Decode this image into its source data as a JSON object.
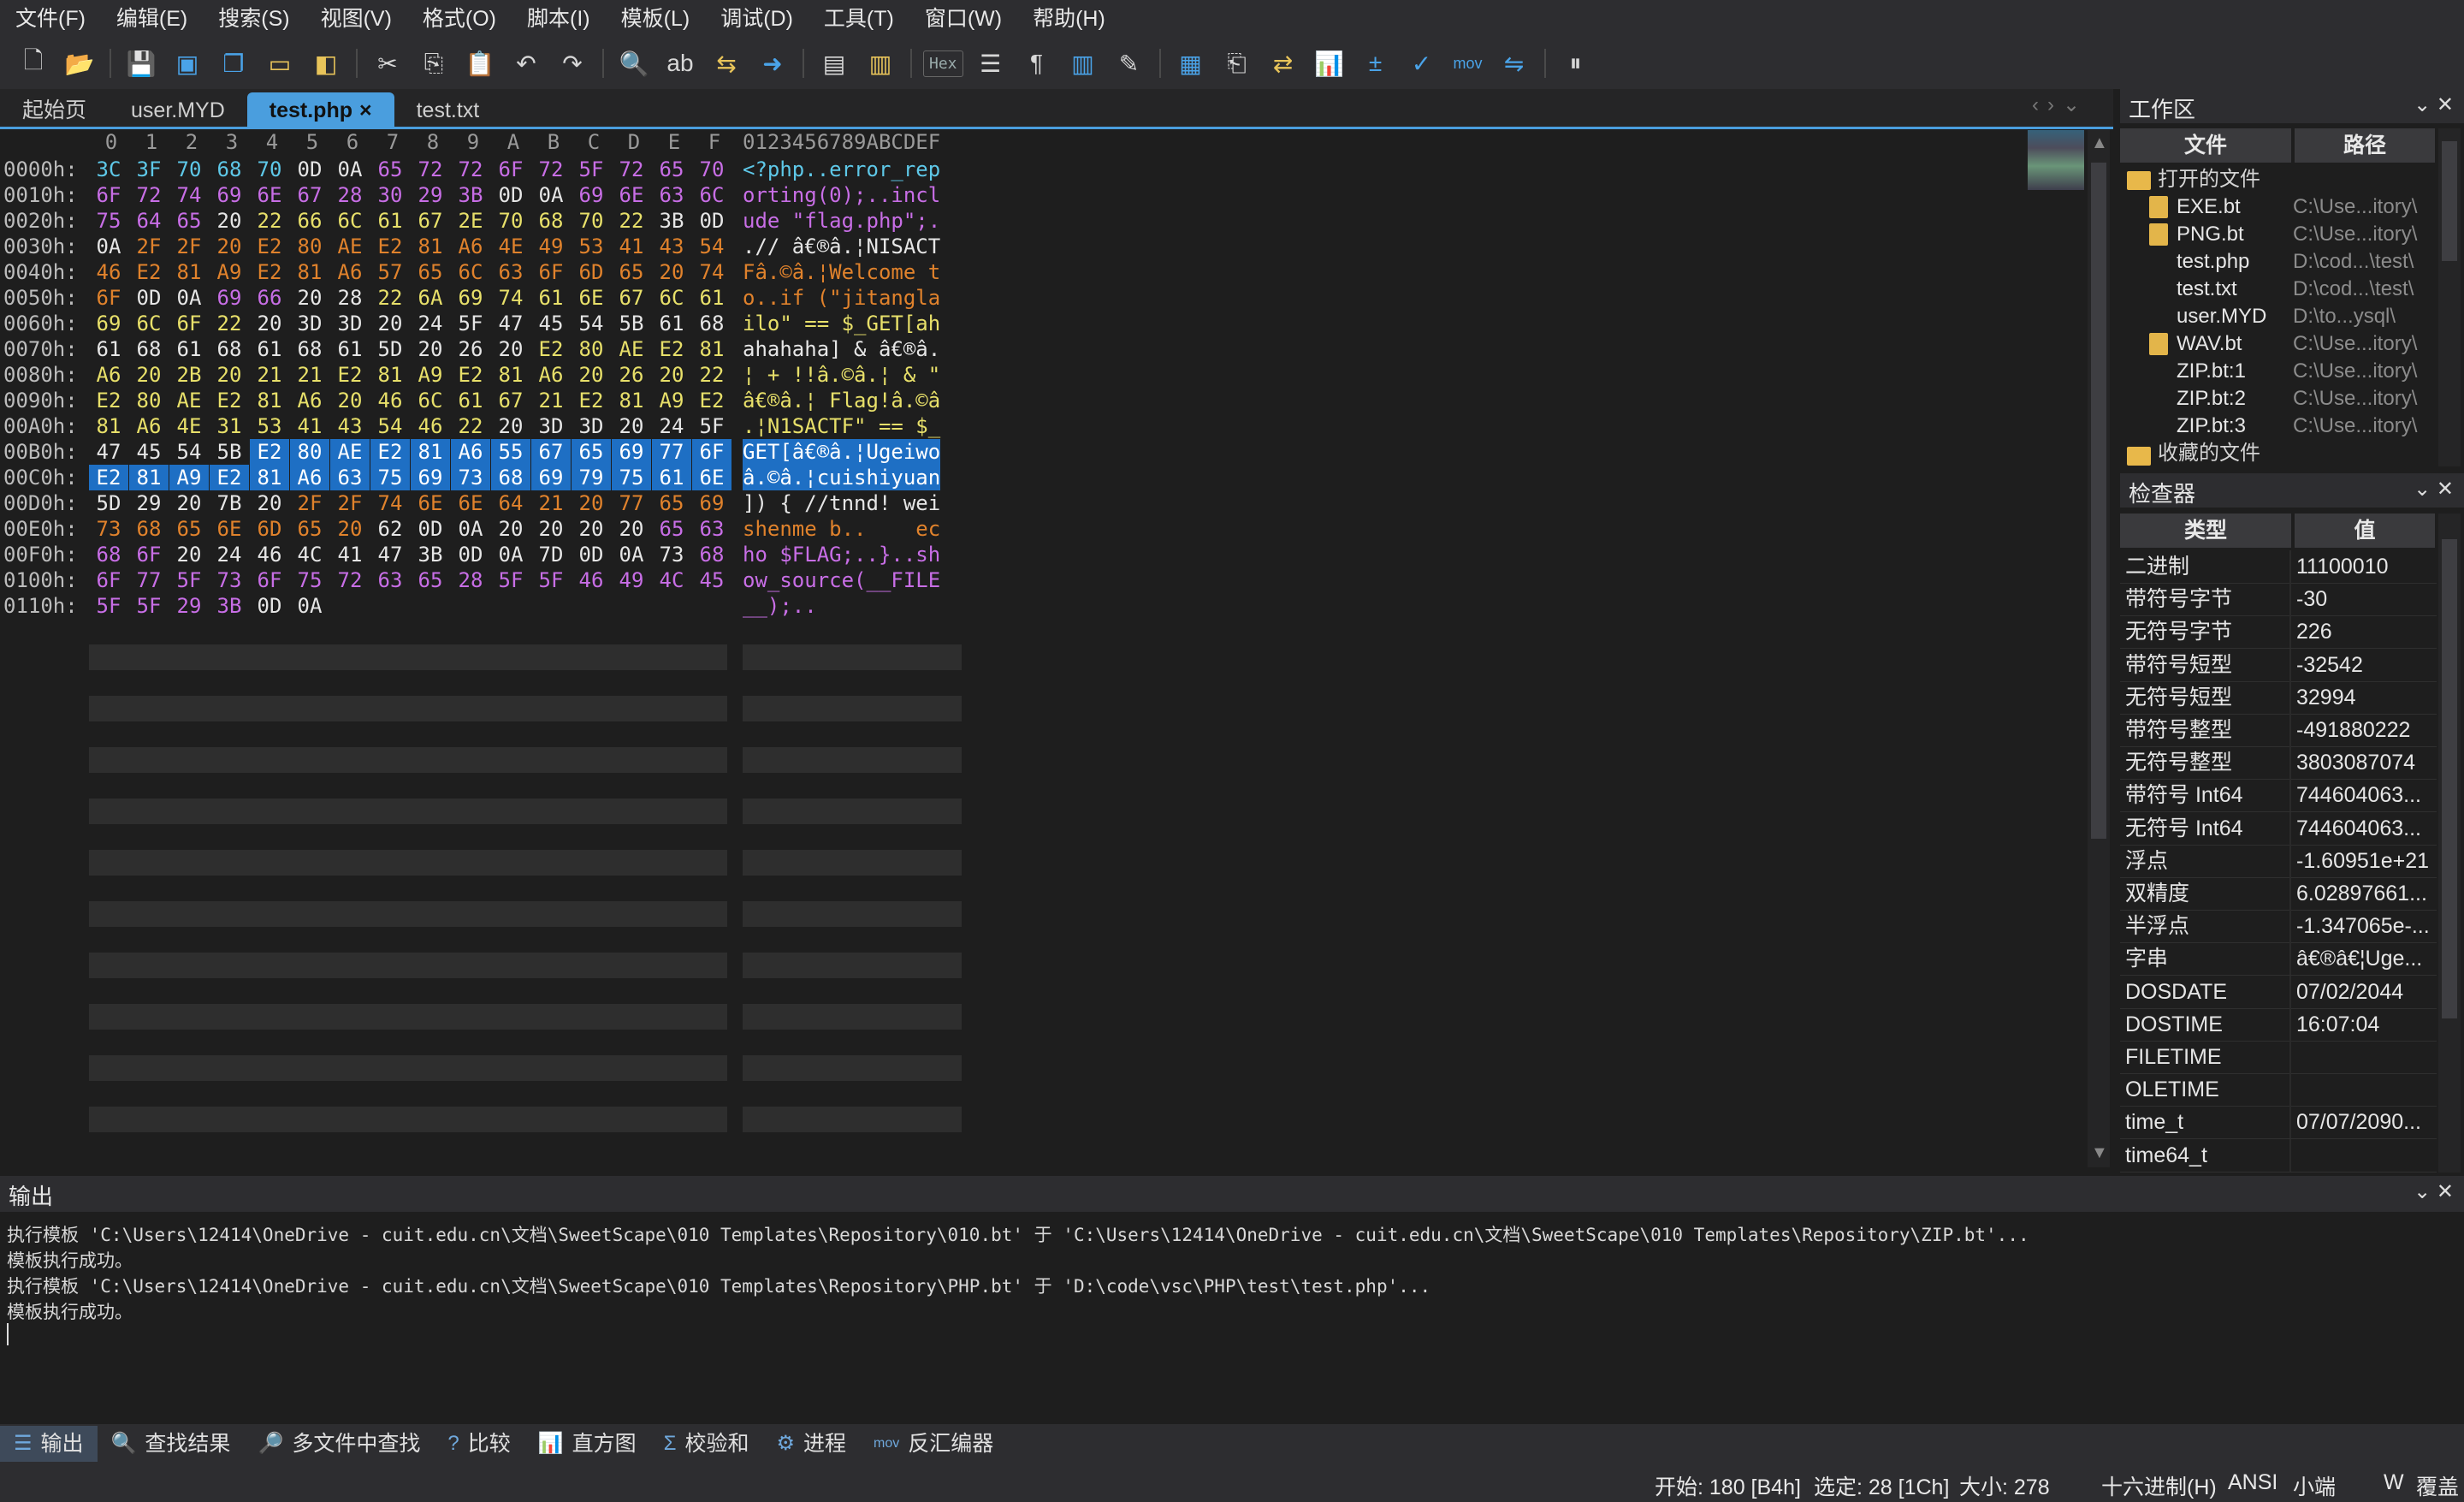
{
  "menu": [
    "文件(F)",
    "编辑(E)",
    "搜索(S)",
    "视图(V)",
    "格式(O)",
    "脚本(I)",
    "模板(L)",
    "调试(D)",
    "工具(T)",
    "窗口(W)",
    "帮助(H)"
  ],
  "toolbar": {
    "hex_label": "Hex",
    "mov_label": "mov"
  },
  "tabs": [
    {
      "label": "起始页",
      "active": false
    },
    {
      "label": "user.MYD",
      "active": false
    },
    {
      "label": "test.php",
      "active": true,
      "close": "×"
    },
    {
      "label": "test.txt",
      "active": false
    }
  ],
  "hex": {
    "columns": [
      "0",
      "1",
      "2",
      "3",
      "4",
      "5",
      "6",
      "7",
      "8",
      "9",
      "A",
      "B",
      "C",
      "D",
      "E",
      "F"
    ],
    "ascii_header": "0123456789ABCDEF",
    "rows": [
      {
        "offset": "0000h:",
        "bytes": [
          "3C",
          "3F",
          "70",
          "68",
          "70",
          "0D",
          "0A",
          "65",
          "72",
          "72",
          "6F",
          "72",
          "5F",
          "72",
          "65",
          "70"
        ],
        "ascii": "<?php..error_rep"
      },
      {
        "offset": "0010h:",
        "bytes": [
          "6F",
          "72",
          "74",
          "69",
          "6E",
          "67",
          "28",
          "30",
          "29",
          "3B",
          "0D",
          "0A",
          "69",
          "6E",
          "63",
          "6C"
        ],
        "ascii": "orting(0);..incl"
      },
      {
        "offset": "0020h:",
        "bytes": [
          "75",
          "64",
          "65",
          "20",
          "22",
          "66",
          "6C",
          "61",
          "67",
          "2E",
          "70",
          "68",
          "70",
          "22",
          "3B",
          "0D"
        ],
        "ascii": "ude \"flag.php\";."
      },
      {
        "offset": "0030h:",
        "bytes": [
          "0A",
          "2F",
          "2F",
          "20",
          "E2",
          "80",
          "AE",
          "E2",
          "81",
          "A6",
          "4E",
          "49",
          "53",
          "41",
          "43",
          "54"
        ],
        "ascii": ".// â€®â.¦NISACT"
      },
      {
        "offset": "0040h:",
        "bytes": [
          "46",
          "E2",
          "81",
          "A9",
          "E2",
          "81",
          "A6",
          "57",
          "65",
          "6C",
          "63",
          "6F",
          "6D",
          "65",
          "20",
          "74"
        ],
        "ascii": "Fâ.©â.¦Welcome t"
      },
      {
        "offset": "0050h:",
        "bytes": [
          "6F",
          "0D",
          "0A",
          "69",
          "66",
          "20",
          "28",
          "22",
          "6A",
          "69",
          "74",
          "61",
          "6E",
          "67",
          "6C",
          "61"
        ],
        "ascii": "o..if (\"jitangla"
      },
      {
        "offset": "0060h:",
        "bytes": [
          "69",
          "6C",
          "6F",
          "22",
          "20",
          "3D",
          "3D",
          "20",
          "24",
          "5F",
          "47",
          "45",
          "54",
          "5B",
          "61",
          "68"
        ],
        "ascii": "ilo\" == $_GET[ah"
      },
      {
        "offset": "0070h:",
        "bytes": [
          "61",
          "68",
          "61",
          "68",
          "61",
          "68",
          "61",
          "5D",
          "20",
          "26",
          "20",
          "E2",
          "80",
          "AE",
          "E2",
          "81"
        ],
        "ascii": "ahahaha] & â€®â."
      },
      {
        "offset": "0080h:",
        "bytes": [
          "A6",
          "20",
          "2B",
          "20",
          "21",
          "21",
          "E2",
          "81",
          "A9",
          "E2",
          "81",
          "A6",
          "20",
          "26",
          "20",
          "22"
        ],
        "ascii": "¦ + !!â.©â.¦ & \""
      },
      {
        "offset": "0090h:",
        "bytes": [
          "E2",
          "80",
          "AE",
          "E2",
          "81",
          "A6",
          "20",
          "46",
          "6C",
          "61",
          "67",
          "21",
          "E2",
          "81",
          "A9",
          "E2"
        ],
        "ascii": "â€®â.¦ Flag!â.©â"
      },
      {
        "offset": "00A0h:",
        "bytes": [
          "81",
          "A6",
          "4E",
          "31",
          "53",
          "41",
          "43",
          "54",
          "46",
          "22",
          "20",
          "3D",
          "3D",
          "20",
          "24",
          "5F"
        ],
        "ascii": ".¦N1SACTF\" == $_"
      },
      {
        "offset": "00B0h:",
        "bytes": [
          "47",
          "45",
          "54",
          "5B",
          "E2",
          "80",
          "AE",
          "E2",
          "81",
          "A6",
          "55",
          "67",
          "65",
          "69",
          "77",
          "6F"
        ],
        "ascii": "GET[â€®â.¦Ugeiwo"
      },
      {
        "offset": "00C0h:",
        "bytes": [
          "E2",
          "81",
          "A9",
          "E2",
          "81",
          "A6",
          "63",
          "75",
          "69",
          "73",
          "68",
          "69",
          "79",
          "75",
          "61",
          "6E"
        ],
        "ascii": "â.©â.¦cuishiyuan"
      },
      {
        "offset": "00D0h:",
        "bytes": [
          "5D",
          "29",
          "20",
          "7B",
          "20",
          "2F",
          "2F",
          "74",
          "6E",
          "6E",
          "64",
          "21",
          "20",
          "77",
          "65",
          "69"
        ],
        "ascii": "]) { //tnnd! wei"
      },
      {
        "offset": "00E0h:",
        "bytes": [
          "73",
          "68",
          "65",
          "6E",
          "6D",
          "65",
          "20",
          "62",
          "0D",
          "0A",
          "20",
          "20",
          "20",
          "20",
          "65",
          "63"
        ],
        "ascii": "shenme b..    ec"
      },
      {
        "offset": "00F0h:",
        "bytes": [
          "68",
          "6F",
          "20",
          "24",
          "46",
          "4C",
          "41",
          "47",
          "3B",
          "0D",
          "0A",
          "7D",
          "0D",
          "0A",
          "73",
          "68"
        ],
        "ascii": "ho $FLAG;..}..sh"
      },
      {
        "offset": "0100h:",
        "bytes": [
          "6F",
          "77",
          "5F",
          "73",
          "6F",
          "75",
          "72",
          "63",
          "65",
          "28",
          "5F",
          "5F",
          "46",
          "49",
          "4C",
          "45"
        ],
        "ascii": "ow_source(__FILE"
      },
      {
        "offset": "0110h:",
        "bytes": [
          "5F",
          "5F",
          "29",
          "3B",
          "0D",
          "0A"
        ],
        "ascii": "__);.."
      }
    ]
  },
  "workspace": {
    "title": "工作区",
    "col_file": "文件",
    "col_path": "路径",
    "open_files_label": "打开的文件",
    "favorites_label": "收藏的文件",
    "files": [
      {
        "name": "EXE.bt",
        "path": "C:\\Use...itory\\",
        "icon": true
      },
      {
        "name": "PNG.bt",
        "path": "C:\\Use...itory\\",
        "icon": true
      },
      {
        "name": "test.php",
        "path": "D:\\cod...\\test\\",
        "icon": false
      },
      {
        "name": "test.txt",
        "path": "D:\\cod...\\test\\",
        "icon": false
      },
      {
        "name": "user.MYD",
        "path": "D:\\to...ysql\\",
        "icon": false
      },
      {
        "name": "WAV.bt",
        "path": "C:\\Use...itory\\",
        "icon": true
      },
      {
        "name": "ZIP.bt:1",
        "path": "C:\\Use...itory\\",
        "icon": false
      },
      {
        "name": "ZIP.bt:2",
        "path": "C:\\Use...itory\\",
        "icon": false
      },
      {
        "name": "ZIP.bt:3",
        "path": "C:\\Use...itory\\",
        "icon": false
      }
    ]
  },
  "inspector": {
    "title": "检查器",
    "col_type": "类型",
    "col_value": "值",
    "rows": [
      {
        "type": "二进制",
        "value": "11100010"
      },
      {
        "type": "带符号字节",
        "value": "-30"
      },
      {
        "type": "无符号字节",
        "value": "226"
      },
      {
        "type": "带符号短型",
        "value": "-32542"
      },
      {
        "type": "无符号短型",
        "value": "32994"
      },
      {
        "type": "带符号整型",
        "value": "-491880222"
      },
      {
        "type": "无符号整型",
        "value": "3803087074"
      },
      {
        "type": "带符号 Int64",
        "value": "744604063..."
      },
      {
        "type": "无符号 Int64",
        "value": "744604063..."
      },
      {
        "type": "浮点",
        "value": "-1.60951e+21"
      },
      {
        "type": "双精度",
        "value": "6.02897661..."
      },
      {
        "type": "半浮点",
        "value": "-1.347065e-..."
      },
      {
        "type": "字串",
        "value": "â€®â€¦Uge..."
      },
      {
        "type": "DOSDATE",
        "value": "07/02/2044"
      },
      {
        "type": "DOSTIME",
        "value": "16:07:04"
      },
      {
        "type": "FILETIME",
        "value": ""
      },
      {
        "type": "OLETIME",
        "value": ""
      },
      {
        "type": "time_t",
        "value": "07/07/2090..."
      },
      {
        "type": "time64_t",
        "value": ""
      }
    ]
  },
  "output": {
    "title": "输出",
    "lines": [
      "执行模板 'C:\\Users\\12414\\OneDrive - cuit.edu.cn\\文档\\SweetScape\\010 Templates\\Repository\\010.bt' 于 'C:\\Users\\12414\\OneDrive - cuit.edu.cn\\文档\\SweetScape\\010 Templates\\Repository\\ZIP.bt'...",
      "模板执行成功。",
      "执行模板 'C:\\Users\\12414\\OneDrive - cuit.edu.cn\\文档\\SweetScape\\010 Templates\\Repository\\PHP.bt' 于 'D:\\code\\vsc\\PHP\\test\\test.php'...",
      "模板执行成功。"
    ]
  },
  "bottom_tabs": [
    {
      "label": "输出",
      "icon": "output-icon",
      "active": true
    },
    {
      "label": "查找结果",
      "icon": "find-icon",
      "active": false
    },
    {
      "label": "多文件中查找",
      "icon": "find-in-files-icon",
      "active": false
    },
    {
      "label": "比较",
      "icon": "compare-icon",
      "active": false
    },
    {
      "label": "直方图",
      "icon": "histogram-icon",
      "active": false
    },
    {
      "label": "校验和",
      "icon": "checksum-icon",
      "active": false
    },
    {
      "label": "进程",
      "icon": "process-icon",
      "active": false
    },
    {
      "label": "反汇编器",
      "icon": "disassembler-icon",
      "active": false
    }
  ],
  "status": {
    "start": "开始: 180 [B4h]",
    "selected": "选定: 28 [1Ch]",
    "size": "大小: 278",
    "mode": "十六进制(H)",
    "encoding": "ANSI",
    "endian": "小端",
    "w": "W",
    "overwrite": "覆盖"
  },
  "colors": {
    "selection": "#1e6fc4",
    "tag": "#5ec8e8",
    "keyword": "#c86ee6",
    "string": "#e8e06a",
    "comment": "#e0822c",
    "plain": "#e6e6e6"
  }
}
